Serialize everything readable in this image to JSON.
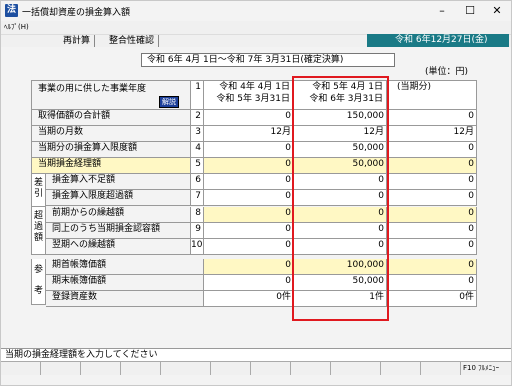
{
  "window": {
    "title": "一括償却資産の損金算入額",
    "icon_text": "法",
    "controls": {
      "minimize": "–",
      "maximize": "☐",
      "close": "✕"
    }
  },
  "menu": {
    "help": "ﾍﾙﾌﾟ(H)"
  },
  "toolbar": {
    "btn1": "再計算",
    "btn2": "整合性確認",
    "date": "令和 6年12月27日(金)"
  },
  "period": "令和 6年 4月 1日～令和 7年 3月31日(確定決算)",
  "unit": "(単位：円)",
  "header": {
    "label": "事業の用に供した事業年度",
    "kaisetsu": "解説",
    "num": "1",
    "col1": [
      "令和 4年 4月 1日",
      "令和 5年 3月31日"
    ],
    "col2": [
      "令和 5年 4月 1日",
      "令和 6年 3月31日"
    ],
    "col3": "(当期分)"
  },
  "rows": [
    {
      "label": "取得価額の合計額",
      "num": "2",
      "c1": "0",
      "c2": "150,000",
      "c3": "0"
    },
    {
      "label": "当期の月数",
      "num": "3",
      "c1": "12月",
      "c2": "12月",
      "c3": "12月"
    },
    {
      "label": "当期分の損金算入限度額",
      "num": "4",
      "c1": "0",
      "c2": "50,000",
      "c3": "0"
    },
    {
      "label": "当期損金経理額",
      "num": "5",
      "c1": "0",
      "c2": "50,000",
      "c3": "0"
    },
    {
      "label": "損金算入不足額",
      "num": "6",
      "c1": "0",
      "c2": "0",
      "c3": "0"
    },
    {
      "label": "損金算入限度超過額",
      "num": "7",
      "c1": "0",
      "c2": "0",
      "c3": "0"
    },
    {
      "label": "前期からの繰越額",
      "num": "8",
      "c1": "0",
      "c2": "0",
      "c3": "0"
    },
    {
      "label": "同上のうち当期損金認容額",
      "num": "9",
      "c1": "0",
      "c2": "0",
      "c3": "0"
    },
    {
      "label": "翌期への繰越額",
      "num": "10",
      "c1": "0",
      "c2": "0",
      "c3": "0"
    },
    {
      "label": "期首帳簿価額",
      "num": "",
      "c1": "0",
      "c2": "100,000",
      "c3": "0"
    },
    {
      "label": "期末帳簿価額",
      "num": "",
      "c1": "0",
      "c2": "50,000",
      "c3": "0"
    },
    {
      "label": "登録資産数",
      "num": "",
      "c1": "0件",
      "c2": "1件",
      "c3": "0件"
    }
  ],
  "groups": {
    "sahiki": [
      "差",
      "引"
    ],
    "chouka": [
      "超",
      "過",
      "額"
    ],
    "sankou": [
      "参",
      "考"
    ]
  },
  "status": "当期の損金経理額を入力してください",
  "fkey": {
    "f10": "F10 ﾌﾙﾒﾆｭｰ"
  }
}
